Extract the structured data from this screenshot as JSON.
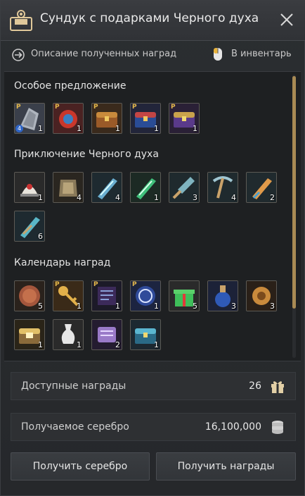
{
  "title": "Сундук с подарками Черного духа",
  "subbar": {
    "description": "Описание полученных наград",
    "inventory": "В инвентарь"
  },
  "sections": [
    {
      "title": "Особое предложение",
      "items": [
        {
          "icon": "chainmail-item-icon",
          "premium": true,
          "count": "1",
          "badge": "4"
        },
        {
          "icon": "red-ornament-item-icon",
          "premium": true,
          "count": "1"
        },
        {
          "icon": "brown-chest-icon",
          "premium": true,
          "count": "1"
        },
        {
          "icon": "blue-chest-icon",
          "premium": true,
          "count": "1"
        },
        {
          "icon": "purple-chest-icon",
          "premium": true,
          "count": "1"
        }
      ]
    },
    {
      "title": "Приключение Черного духа",
      "items": [
        {
          "icon": "headgear-item-icon",
          "count": "1"
        },
        {
          "icon": "armor-item-icon",
          "count": "4"
        },
        {
          "icon": "blue-shard-icon",
          "count": "4"
        },
        {
          "icon": "green-shard-icon",
          "count": "1"
        },
        {
          "icon": "shovel-icon",
          "count": "3"
        },
        {
          "icon": "pickaxe-icon",
          "count": "4"
        },
        {
          "icon": "orange-shard-icon",
          "count": "2"
        },
        {
          "icon": "teal-shard-icon",
          "count": "6"
        }
      ]
    },
    {
      "title": "Календарь наград",
      "items": [
        {
          "icon": "coin-item-icon",
          "count": "5"
        },
        {
          "icon": "gold-key-icon",
          "premium": true,
          "count": "1"
        },
        {
          "icon": "dark-scroll-icon",
          "premium": true,
          "count": "1"
        },
        {
          "icon": "blue-emblem-icon",
          "premium": true,
          "count": "1"
        },
        {
          "icon": "gift-box-icon",
          "count": "5"
        },
        {
          "icon": "blue-potion-icon",
          "count": "3"
        },
        {
          "icon": "gold-gear-icon",
          "count": "3"
        },
        {
          "icon": "gold-chest-icon",
          "count": "1"
        },
        {
          "icon": "white-vase-icon",
          "count": "1"
        },
        {
          "icon": "purple-scroll-icon",
          "count": "2"
        },
        {
          "icon": "teal-chest-icon",
          "count": "1"
        }
      ]
    }
  ],
  "available": {
    "label": "Доступные награды",
    "value": "26"
  },
  "silver": {
    "label": "Получаемое серебро",
    "value": "16,100,000"
  },
  "buttons": {
    "get_silver": "Получить серебро",
    "get_rewards": "Получить награды"
  }
}
